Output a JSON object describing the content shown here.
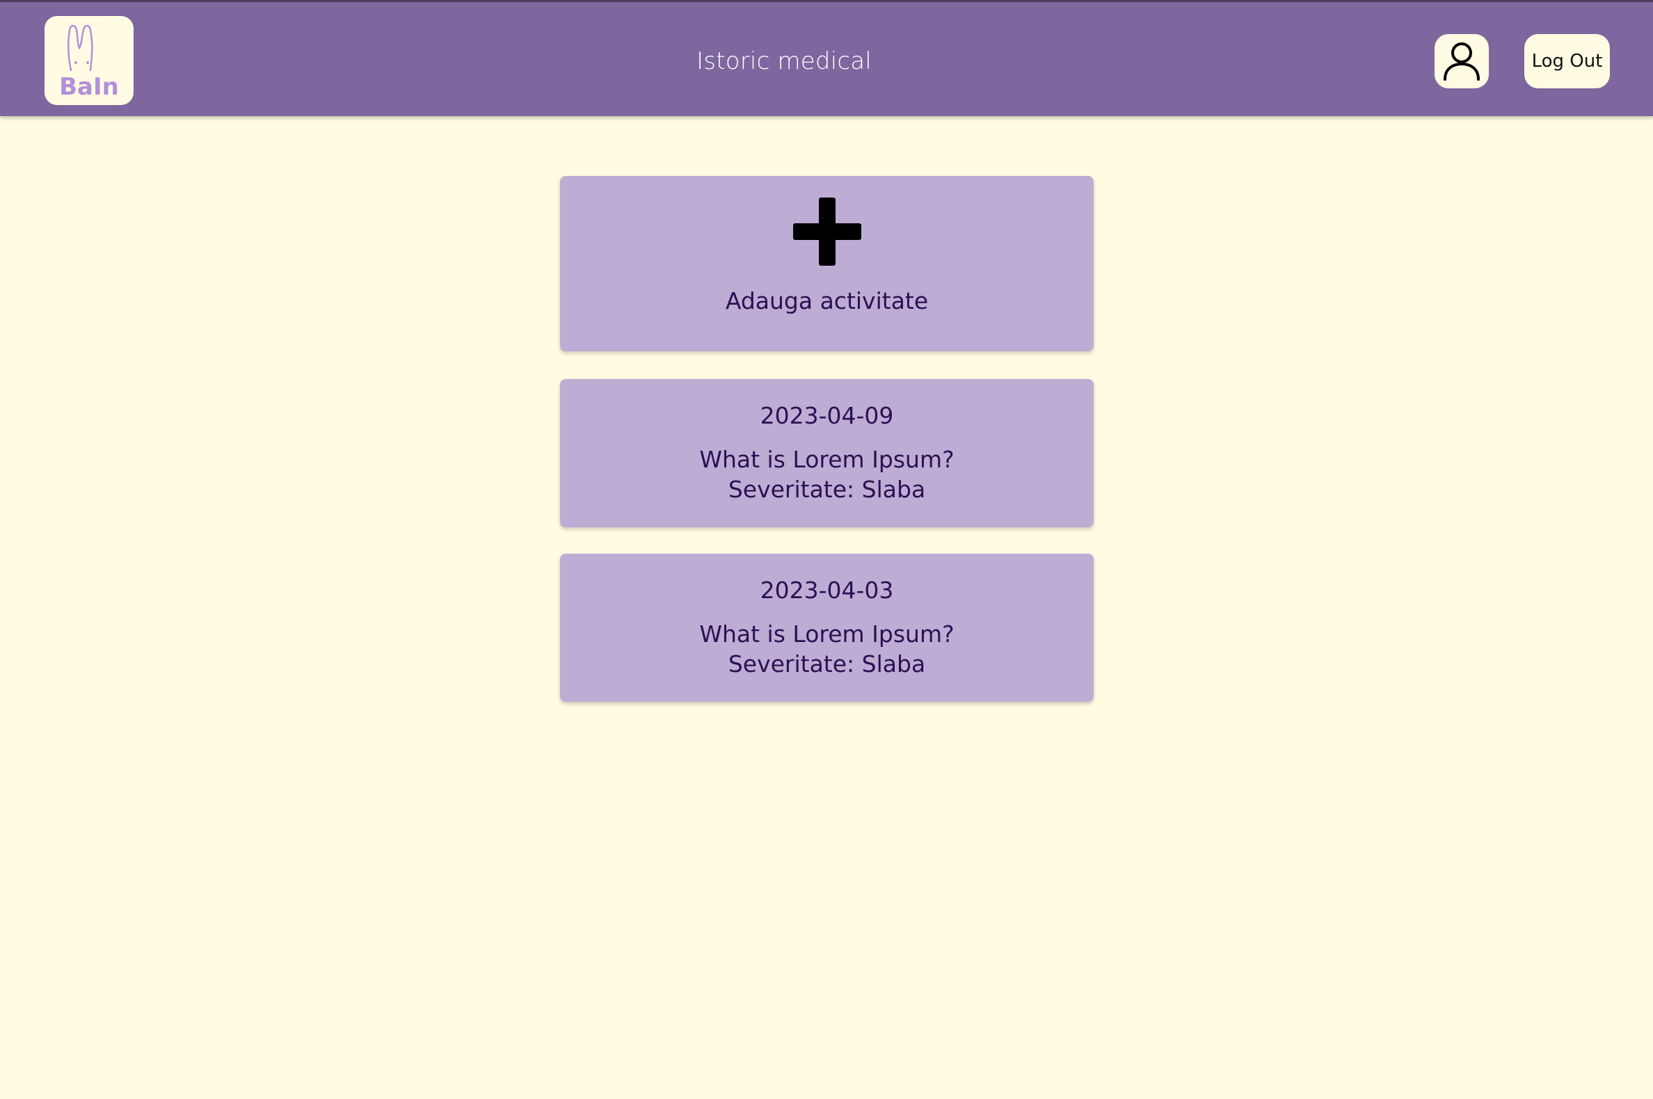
{
  "app": {
    "logo_text": "BaIn",
    "logo_icon": "rabbit-ears-icon"
  },
  "header": {
    "title": "Istoric medical",
    "profile_icon": "user-icon",
    "logout_label": "Log Out"
  },
  "add_activity": {
    "icon": "plus-icon",
    "label": "Adauga activitate"
  },
  "entries": [
    {
      "date": "2023-04-09",
      "description": "What is Lorem Ipsum?",
      "severity": "Severitate: Slaba"
    },
    {
      "date": "2023-04-03",
      "description": "What is Lorem Ipsum?",
      "severity": "Severitate: Slaba"
    }
  ],
  "colors": {
    "header_bg": "#7e669e",
    "page_bg": "#fffce3",
    "card_bg": "#bdadd4",
    "card_text": "#2c1054",
    "logo_accent": "#b48ed8"
  }
}
